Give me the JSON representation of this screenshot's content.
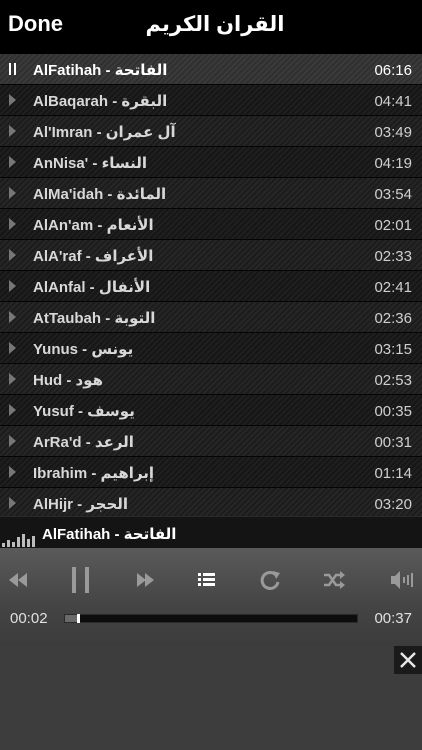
{
  "header": {
    "done_label": "Done",
    "title": "القران الكريم"
  },
  "tracks": [
    {
      "name": "AlFatihah - الفاتحة",
      "duration": "06:16",
      "playing": true
    },
    {
      "name": "AlBaqarah - البقرة",
      "duration": "04:41"
    },
    {
      "name": "Al'Imran - آل عمران",
      "duration": "03:49"
    },
    {
      "name": "AnNisa' - النساء",
      "duration": "04:19"
    },
    {
      "name": "AlMa'idah - المائدة",
      "duration": "03:54"
    },
    {
      "name": "AlAn'am - الأنعام",
      "duration": "02:01"
    },
    {
      "name": "AlA'raf - الأعراف",
      "duration": "02:33"
    },
    {
      "name": "AlAnfal - الأنفال",
      "duration": "02:41"
    },
    {
      "name": "AtTaubah - التوبة",
      "duration": "02:36"
    },
    {
      "name": "Yunus - يونس",
      "duration": "03:15"
    },
    {
      "name": "Hud - هود",
      "duration": "02:53"
    },
    {
      "name": "Yusuf - يوسف",
      "duration": "00:35"
    },
    {
      "name": "ArRa'd - الرعد",
      "duration": "00:31"
    },
    {
      "name": "Ibrahim - إبراهيم",
      "duration": "01:14"
    },
    {
      "name": "AlHijr - الحجر",
      "duration": "03:20"
    }
  ],
  "now_playing": {
    "title": "AlFatihah - الفاتحة"
  },
  "player": {
    "elapsed": "00:02",
    "total": "00:37",
    "progress": 0.04,
    "icons": [
      "rewind-icon",
      "pause-icon",
      "fast-forward-icon",
      "playlist-icon",
      "repeat-icon",
      "shuffle-icon",
      "volume-icon"
    ]
  },
  "colors": {
    "accent": "#ffffff",
    "controls_bg": "#4a4a4a",
    "list_bg": "#1c1c1c"
  }
}
